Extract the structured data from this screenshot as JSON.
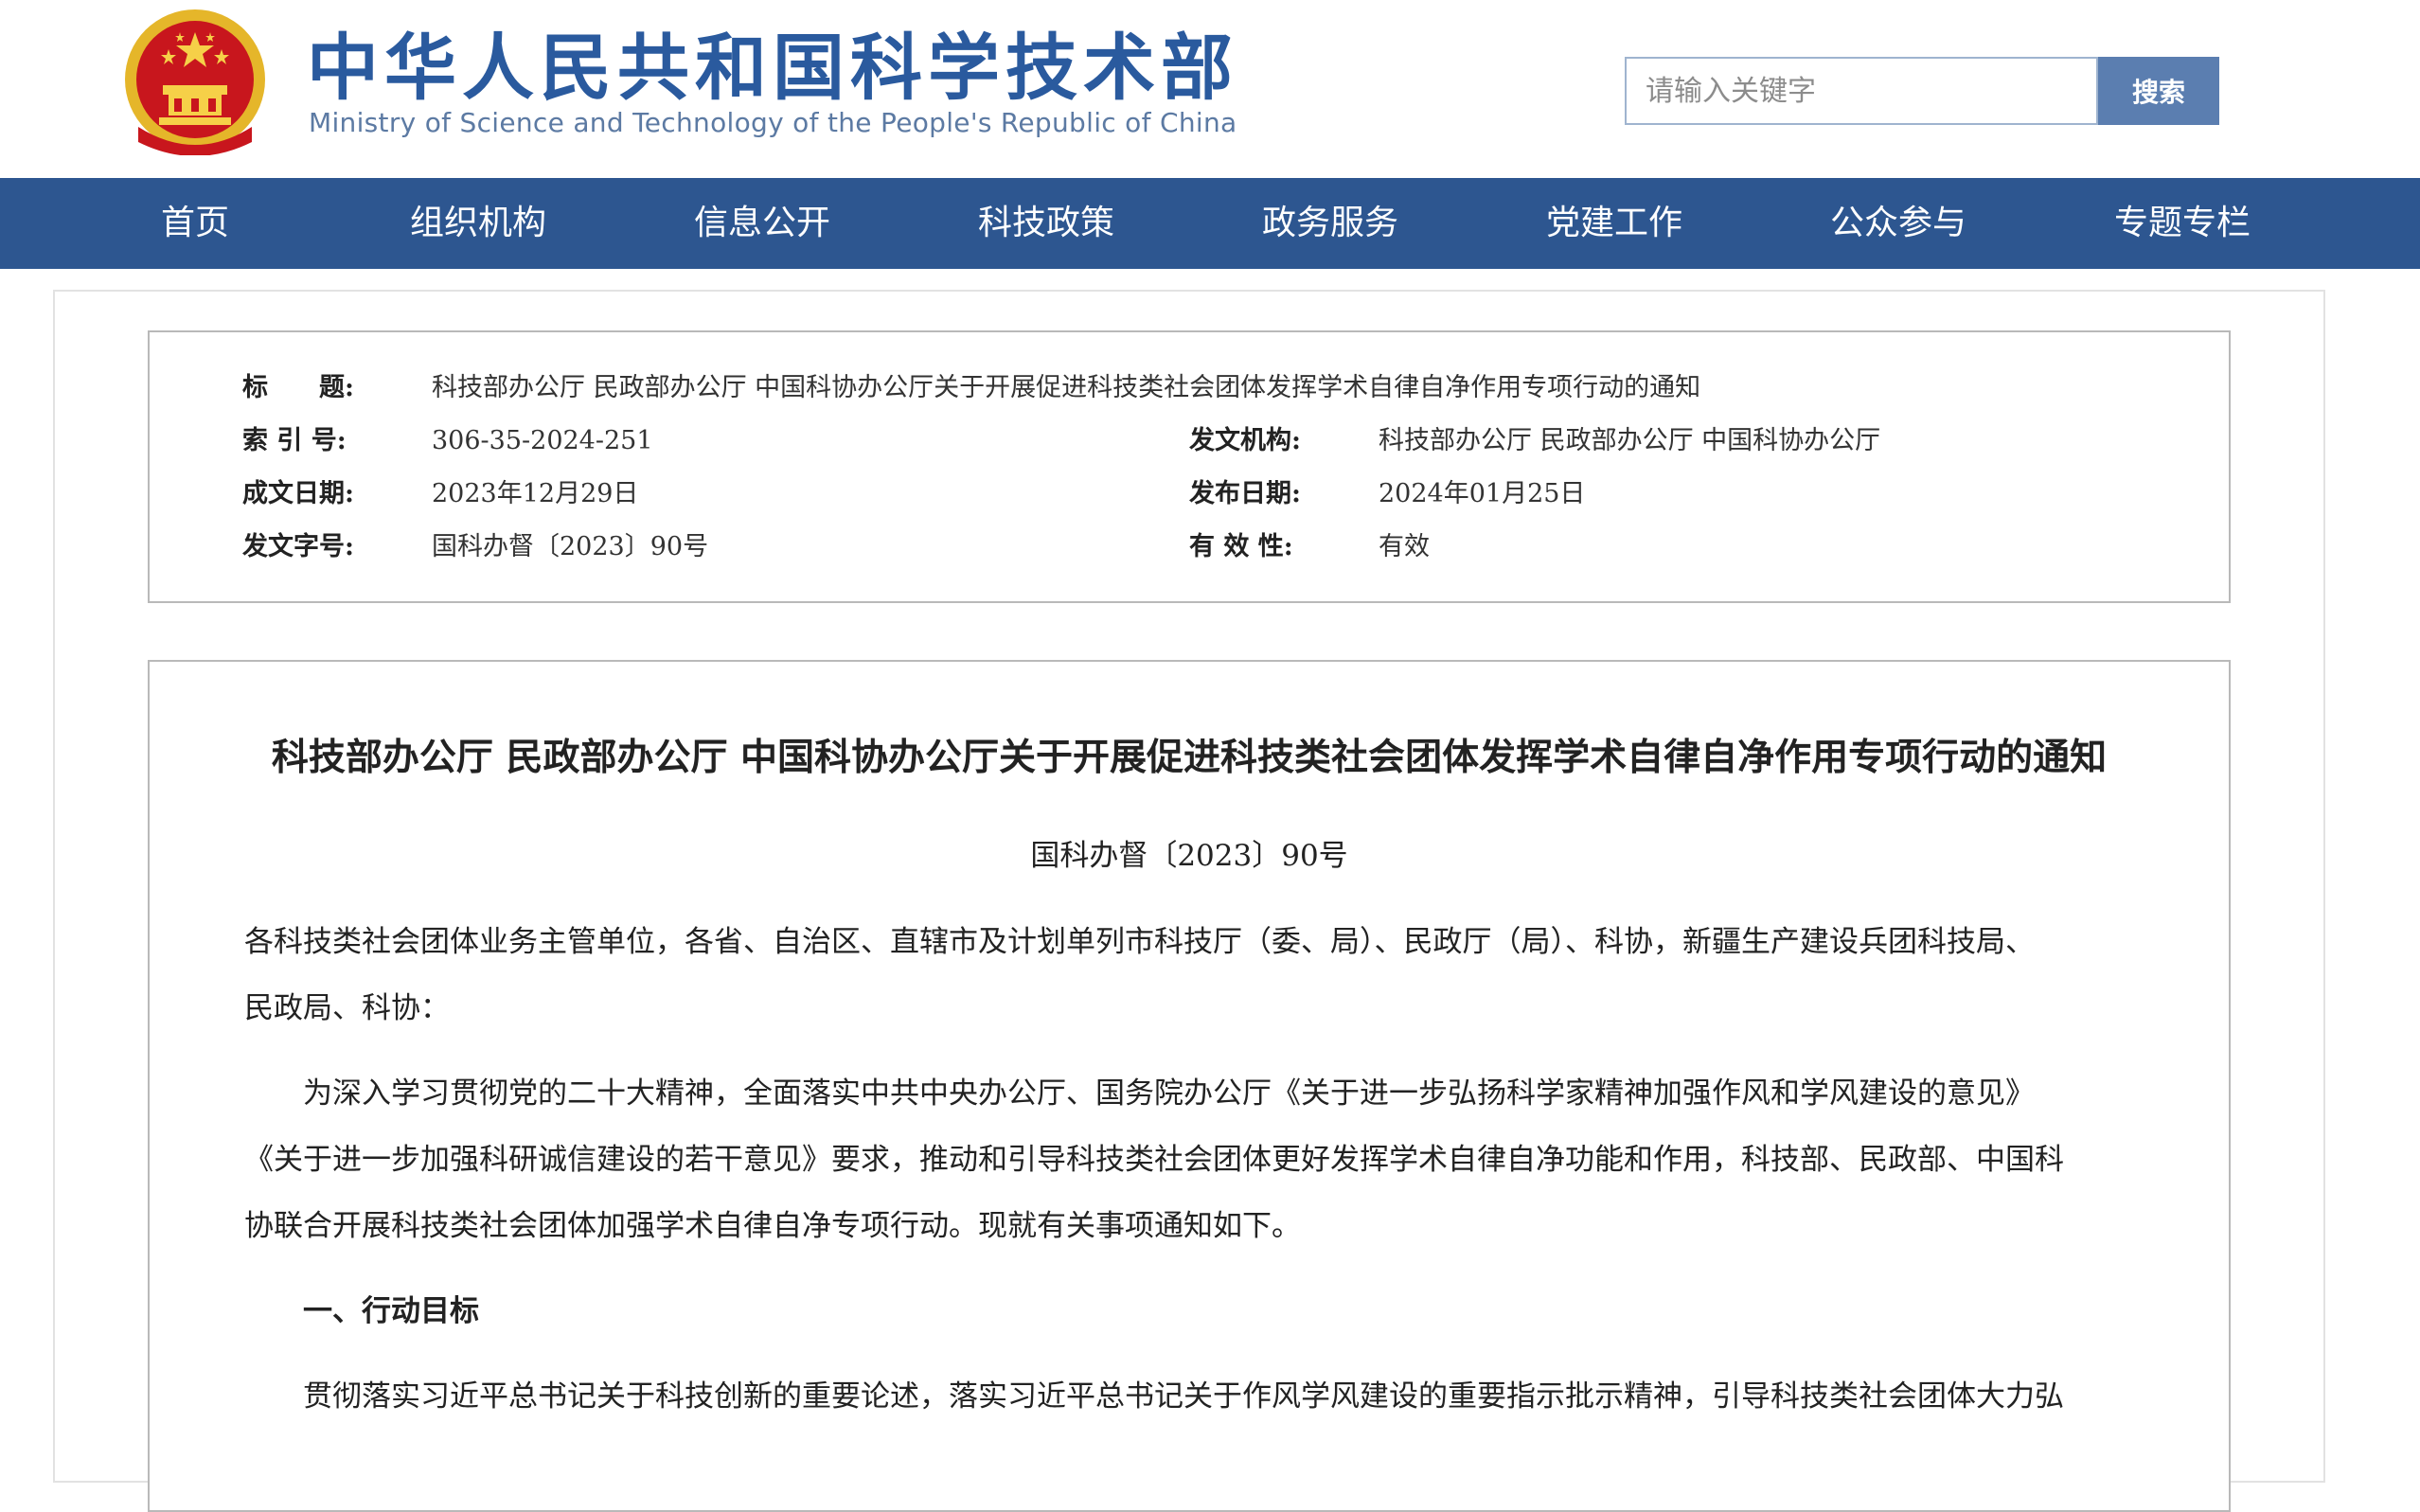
{
  "header": {
    "title": "中华人民共和国科学技术部",
    "subtitle": "Ministry of Science and Technology of the People's Republic of China",
    "emblem_icon": "national-emblem-icon",
    "search": {
      "placeholder": "请输入关键字",
      "value": "",
      "button_label": "搜索"
    }
  },
  "nav": {
    "items": [
      "首页",
      "组织机构",
      "信息公开",
      "科技政策",
      "政务服务",
      "党建工作",
      "公众参与",
      "专题专栏"
    ]
  },
  "info": {
    "title_label": "标　　题:",
    "title_value": "科技部办公厅 民政部办公厅 中国科协办公厅关于开展促进科技类社会团体发挥学术自律自净作用专项行动的通知",
    "index_label": "索 引 号:",
    "index_value": "306-35-2024-251",
    "issuer_label": "发文机构:",
    "issuer_value": "科技部办公厅 民政部办公厅 中国科协办公厅",
    "created_label": "成文日期:",
    "created_value": "2023年12月29日",
    "published_label": "发布日期:",
    "published_value": "2024年01月25日",
    "docno_label": "发文字号:",
    "docno_value": "国科办督〔2023〕90号",
    "validity_label": "有 效 性:",
    "validity_value": "有效"
  },
  "article": {
    "title": "科技部办公厅 民政部办公厅 中国科协办公厅关于开展促进科技类社会团体发挥学术自律自净作用专项行动的通知",
    "doc_number": "国科办督〔2023〕90号",
    "recipients_line1": "各科技类社会团体业务主管单位，各省、自治区、直辖市及计划单列市科技厅（委、局）、民政厅（局）、科协，新疆生产建设兵团科技局、",
    "recipients_line2": "民政局、科协：",
    "intro_line1": "为深入学习贯彻党的二十大精神，全面落实中共中央办公厅、国务院办公厅《关于进一步弘扬科学家精神加强作风和学风建设的意见》",
    "intro_line2": "《关于进一步加强科研诚信建设的若干意见》要求，推动和引导科技类社会团体更好发挥学术自律自净功能和作用，科技部、民政部、中国科",
    "intro_line3": "协联合开展科技类社会团体加强学术自律自净专项行动。现就有关事项通知如下。",
    "section1_heading": "一、行动目标",
    "section1_line1": "贯彻落实习近平总书记关于科技创新的重要论述，落实习近平总书记关于作风学风建设的重要指示批示精神，引导科技类社会团体大力弘"
  },
  "colors": {
    "nav_bg": "#2d5690",
    "title_blue": "#2a5a9e",
    "search_button": "#5b7eb0",
    "emblem_red": "#c8161d",
    "emblem_gold": "#e5b62a"
  }
}
